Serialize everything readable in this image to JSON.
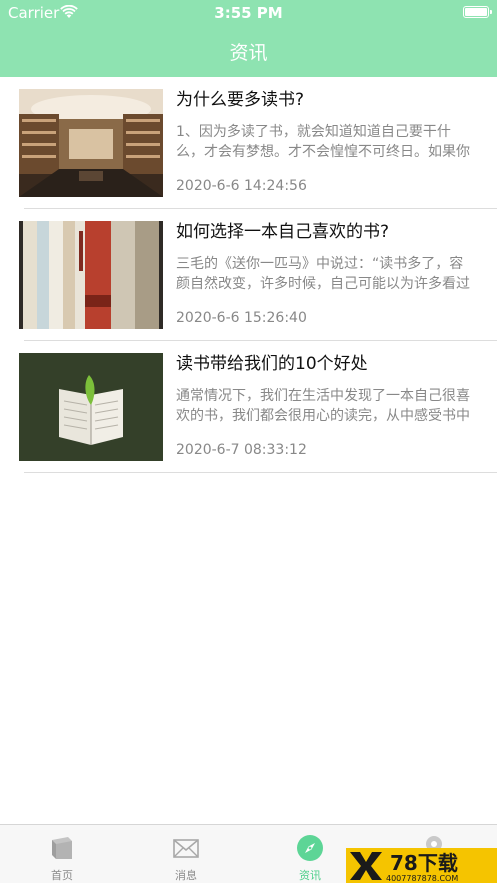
{
  "status_bar": {
    "carrier": "Carrier",
    "time": "3:55 PM",
    "wifi_icon": "wifi-icon",
    "battery_icon": "battery-icon"
  },
  "nav": {
    "title": "资讯"
  },
  "news": [
    {
      "title": "为什么要多读书?",
      "summary": "1、因为多读了书，就会知道知道自己要干什么，才会有梦想。才不会惶惶不可终日。如果你没有梦想，那就只能随波逐流",
      "date": "2020-6-6 14:24:56",
      "image": "bookstore-interior-image"
    },
    {
      "title": "如何选择一本自己喜欢的书?",
      "summary": "三毛的《送你一匹马》中说过：“读书多了，容颜自然改变，许多时候，自己可能以为许多看过的书籍都成过眼云烟",
      "date": "2020-6-6 15:26:40",
      "image": "book-spines-image"
    },
    {
      "title": "读书带给我们的10个好处",
      "summary": "通常情况下，我们在生活中发现了一本自己很喜欢的书，我们都会很用心的读完，从中感受书中的乐趣",
      "date": "2020-6-7 08:33:12",
      "image": "open-book-on-grass-image"
    }
  ],
  "tabbar": {
    "tabs": [
      {
        "label": "首页",
        "icon": "book-icon",
        "active": false
      },
      {
        "label": "消息",
        "icon": "envelope-icon",
        "active": false
      },
      {
        "label": "资讯",
        "icon": "compass-icon",
        "active": true
      },
      {
        "label": "",
        "icon": "profile-icon",
        "active": false
      }
    ]
  },
  "watermark": {
    "brand": "78下载",
    "domain": "4007787878.COM"
  },
  "colors": {
    "accent": "#8ee3b1",
    "active_tab": "#4dcf8a",
    "title_text": "#111111",
    "secondary_text": "#888888"
  }
}
